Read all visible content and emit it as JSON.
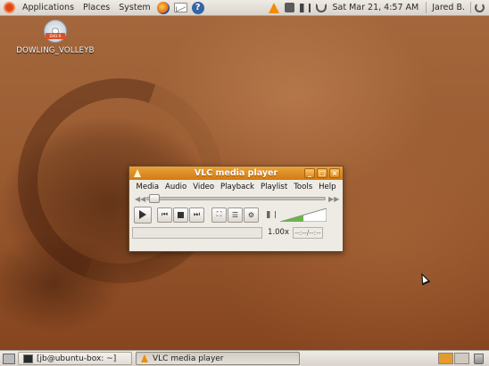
{
  "top_panel": {
    "menus": [
      "Applications",
      "Places",
      "System"
    ],
    "launchers": [
      "firefox-icon",
      "mail-icon",
      "help-icon"
    ],
    "help_glyph": "?",
    "clock": "Sat Mar 21,  4:57 AM",
    "user": "Jared B."
  },
  "desktop": {
    "icon_label": "DOWLING_VOLLEYB",
    "disc_tag": "DVD-R"
  },
  "vlc": {
    "title": "VLC media player",
    "menu": [
      "Media",
      "Audio",
      "Video",
      "Playback",
      "Playlist",
      "Tools",
      "Help"
    ],
    "speed": "1.00x",
    "time": "--:--/--:--",
    "volume_level": 0.5,
    "buttons": {
      "minimize": "_",
      "maximize": "□",
      "close": "×",
      "prev": "⏮",
      "next": "⏭",
      "fullscreen": "⛶",
      "playlist": "☰",
      "extended": "⚙"
    },
    "accent": "#d27a12"
  },
  "bottom_panel": {
    "tasks": [
      {
        "label": "[jb@ubuntu-box: ~]",
        "icon": "terminal-icon"
      },
      {
        "label": "VLC media player",
        "icon": "vlc-icon"
      }
    ],
    "workspaces": 2
  }
}
